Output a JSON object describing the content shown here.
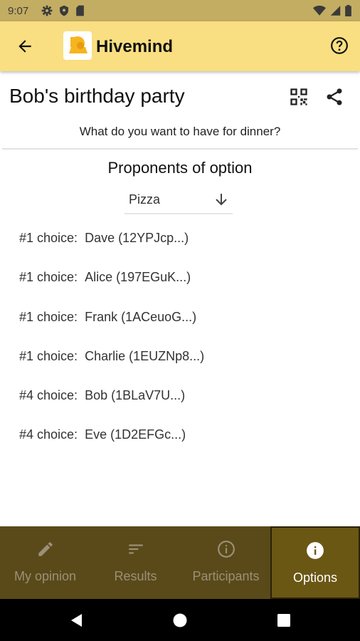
{
  "status_bar": {
    "time": "9:07"
  },
  "app_bar": {
    "title": "Hivemind"
  },
  "page": {
    "title": "Bob's birthday party",
    "question": "What do you want to have for dinner?"
  },
  "proponents": {
    "heading": "Proponents of option",
    "selected_option": "Pizza",
    "rows": [
      {
        "rank": "#1 choice:",
        "name": "Dave (12YPJcp...)"
      },
      {
        "rank": "#1 choice:",
        "name": "Alice (197EGuK...)"
      },
      {
        "rank": "#1 choice:",
        "name": "Frank (1ACeuoG...)"
      },
      {
        "rank": "#1 choice:",
        "name": "Charlie (1EUZNp8...)"
      },
      {
        "rank": "#4 choice:",
        "name": "Bob (1BLaV7U...)"
      },
      {
        "rank": "#4 choice:",
        "name": "Eve (1D2EFGc...)"
      }
    ]
  },
  "bottom_nav": {
    "tabs": [
      {
        "label": "My opinion",
        "icon": "pencil-icon",
        "active": false
      },
      {
        "label": "Results",
        "icon": "sort-lines-icon",
        "active": false
      },
      {
        "label": "Participants",
        "icon": "info-outline-icon",
        "active": false
      },
      {
        "label": "Options",
        "icon": "info-filled-icon",
        "active": true
      }
    ]
  },
  "colors": {
    "status_bar": "#c3ad62",
    "app_bar": "#f9df81",
    "bottom_nav": "#5a4a19",
    "active_tab": "#6a5714"
  }
}
